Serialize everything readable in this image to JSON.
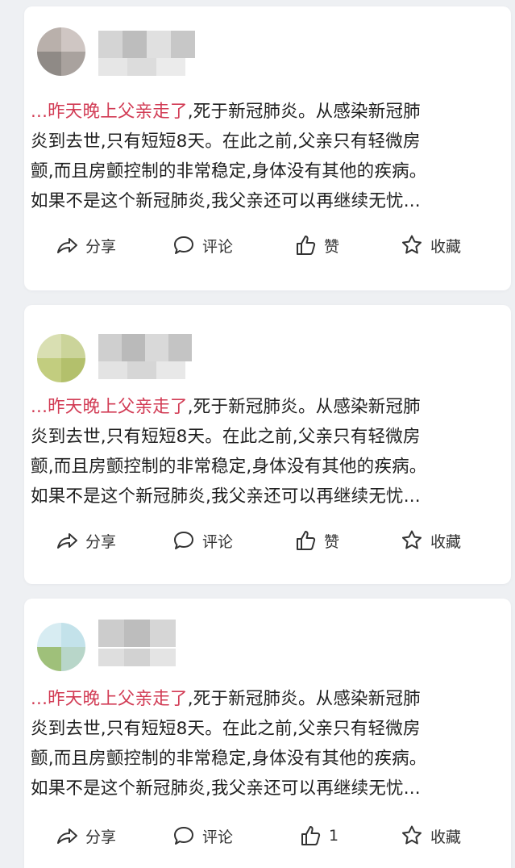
{
  "posts": [
    {
      "content_highlight": "...昨天晚上父亲走了",
      "content_lines": [
        ",死于新冠肺炎。从感染新冠肺",
        "炎到去世,只有短短8天。在此之前,父亲只有轻微房",
        "颤,而且房颤控制的非常稳定,身体没有其他的疾病。",
        "如果不是这个新冠肺炎,我父亲还可以再继续无忧..."
      ],
      "actions": {
        "share": "分享",
        "comment": "评论",
        "like": "赞",
        "favorite": "收藏"
      }
    },
    {
      "content_highlight": "...昨天晚上父亲走了",
      "content_lines": [
        ",死于新冠肺炎。从感染新冠肺",
        "炎到去世,只有短短8天。在此之前,父亲只有轻微房",
        "颤,而且房颤控制的非常稳定,身体没有其他的疾病。",
        "如果不是这个新冠肺炎,我父亲还可以再继续无忧..."
      ],
      "actions": {
        "share": "分享",
        "comment": "评论",
        "like": "赞",
        "favorite": "收藏"
      }
    },
    {
      "content_highlight": "...昨天晚上父亲走了",
      "content_lines": [
        ",死于新冠肺炎。从感染新冠肺",
        "炎到去世,只有短短8天。在此之前,父亲只有轻微房",
        "颤,而且房颤控制的非常稳定,身体没有其他的疾病。",
        "如果不是这个新冠肺炎,我父亲还可以再继续无忧..."
      ],
      "actions": {
        "share": "分享",
        "comment": "评论",
        "like": "1",
        "favorite": "收藏"
      }
    }
  ],
  "icons": [
    "share-icon",
    "comment-icon",
    "like-icon",
    "favorite-icon"
  ],
  "colors": {
    "highlight": "#d23c55",
    "text": "#1f1f1f",
    "background": "#eef0f3",
    "card": "#ffffff"
  }
}
